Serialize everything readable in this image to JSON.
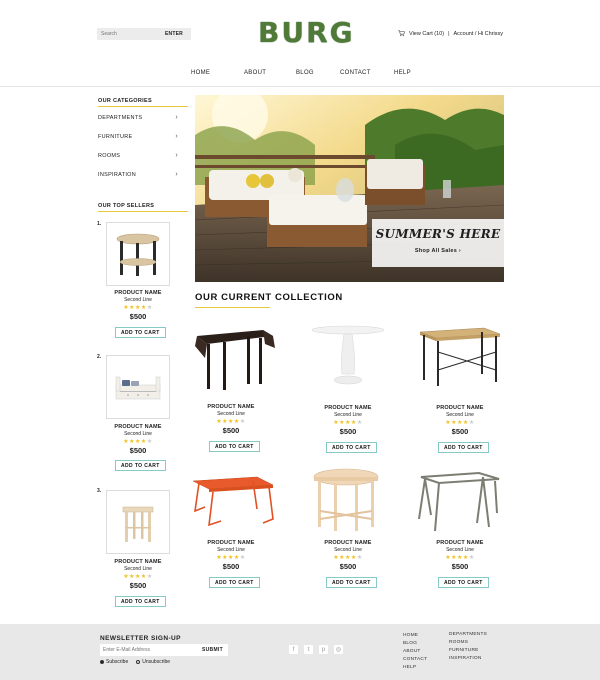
{
  "header": {
    "search_placeholder": "Search",
    "search_button": "ENTER",
    "logo": "BURG",
    "cart": "View Cart (10)",
    "separator": "|",
    "account": "Account / Hi Chrissy"
  },
  "nav": [
    "HOME",
    "ABOUT",
    "BLOG",
    "CONTACT",
    "HELP"
  ],
  "sidebar": {
    "categories_title": "OUR CATEGORIES",
    "categories": [
      "DEPARTMENTS",
      "FURNITURE",
      "ROOMS",
      "INSPIRATION"
    ],
    "chevron": "›",
    "sellers_title": "OUR TOP SELLERS",
    "sellers": [
      {
        "num": "1.",
        "name": "PRODUCT NAME",
        "line": "Second Line",
        "price": "$500",
        "rating": 4,
        "button": "ADD TO CART"
      },
      {
        "num": "2.",
        "name": "PRODUCT NAME",
        "line": "Second Line",
        "price": "$500",
        "rating": 4,
        "button": "ADD TO CART"
      },
      {
        "num": "3.",
        "name": "PRODUCT NAME",
        "line": "Second Line",
        "price": "$500",
        "rating": 4,
        "button": "ADD TO CART"
      }
    ]
  },
  "hero": {
    "headline": "SUMMER'S HERE",
    "cta": "Shop All Sales ›"
  },
  "collection": {
    "title": "OUR CURRENT COLLECTION",
    "products": [
      {
        "name": "PRODUCT NAME",
        "line": "Second Line",
        "price": "$500",
        "rating": 4,
        "button": "ADD TO CART"
      },
      {
        "name": "PRODUCT NAME",
        "line": "Second Line",
        "price": "$500",
        "rating": 4,
        "button": "ADD TO CART"
      },
      {
        "name": "PRODUCT NAME",
        "line": "Second Line",
        "price": "$500",
        "rating": 4,
        "button": "ADD TO CART"
      },
      {
        "name": "PRODUCT NAME",
        "line": "Second Line",
        "price": "$500",
        "rating": 4,
        "button": "ADD TO CART"
      },
      {
        "name": "PRODUCT NAME",
        "line": "Second Line",
        "price": "$500",
        "rating": 4,
        "button": "ADD TO CART"
      },
      {
        "name": "PRODUCT NAME",
        "line": "Second Line",
        "price": "$500",
        "rating": 4,
        "button": "ADD TO CART"
      }
    ]
  },
  "footer": {
    "newsletter_title": "NEWSLETTER SIGN-UP",
    "email_placeholder": "Enter E-Mail Address",
    "submit": "SUBMIT",
    "subscribe": "Subscribe",
    "unsubscribe": "Unsubscribe",
    "social_icons": [
      "facebook-icon",
      "twitter-icon",
      "pinterest-icon",
      "instagram-icon"
    ],
    "links_col1": [
      "HOME",
      "BLOG",
      "ABOUT",
      "CONTACT",
      "HELP"
    ],
    "links_col2": [
      "DEPARTMENTS",
      "ROOMS",
      "FURNITURE",
      "INSPIRATION"
    ]
  },
  "colors": {
    "accent_underline": "#e5c73b",
    "button_border": "#86c9c5",
    "star": "#f0c21c",
    "footer_bg": "#e8e8e8"
  }
}
